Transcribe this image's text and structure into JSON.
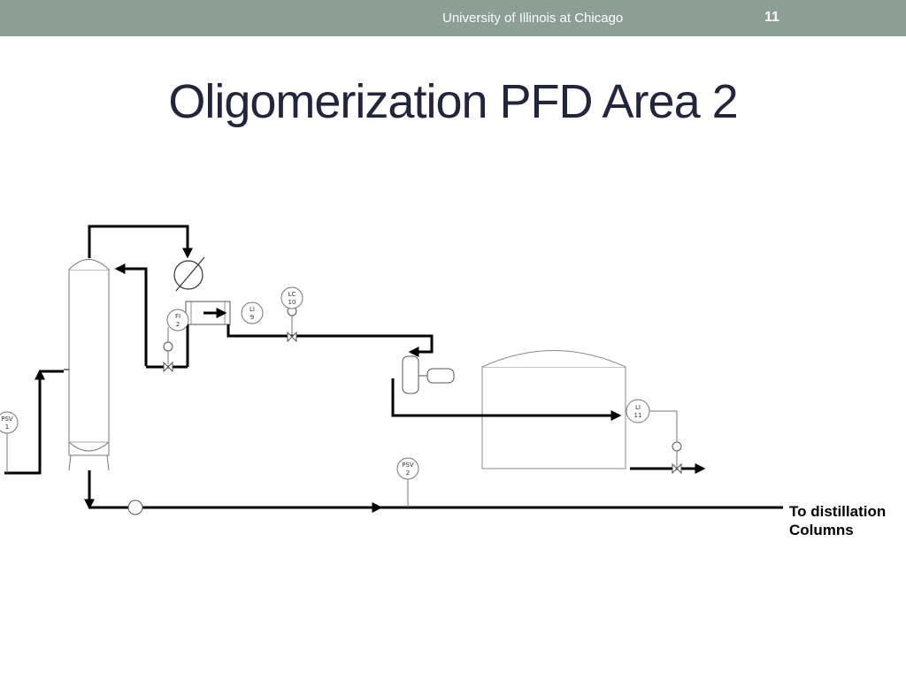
{
  "header": {
    "organization": "University of Illinois at Chicago",
    "page_number": "11"
  },
  "slide": {
    "title": "Oligomerization PFD Area 2"
  },
  "diagram": {
    "instrument_tags": {
      "psv1": [
        "PSV",
        "1"
      ],
      "psv2": [
        "PSV",
        "2"
      ],
      "fi2": [
        "FI",
        "2"
      ],
      "li9": [
        "LI",
        "9"
      ],
      "lc10": [
        "LC",
        "10"
      ],
      "li11": [
        "LI",
        "11"
      ]
    },
    "destination_label": [
      "To distillation",
      "Columns"
    ]
  }
}
